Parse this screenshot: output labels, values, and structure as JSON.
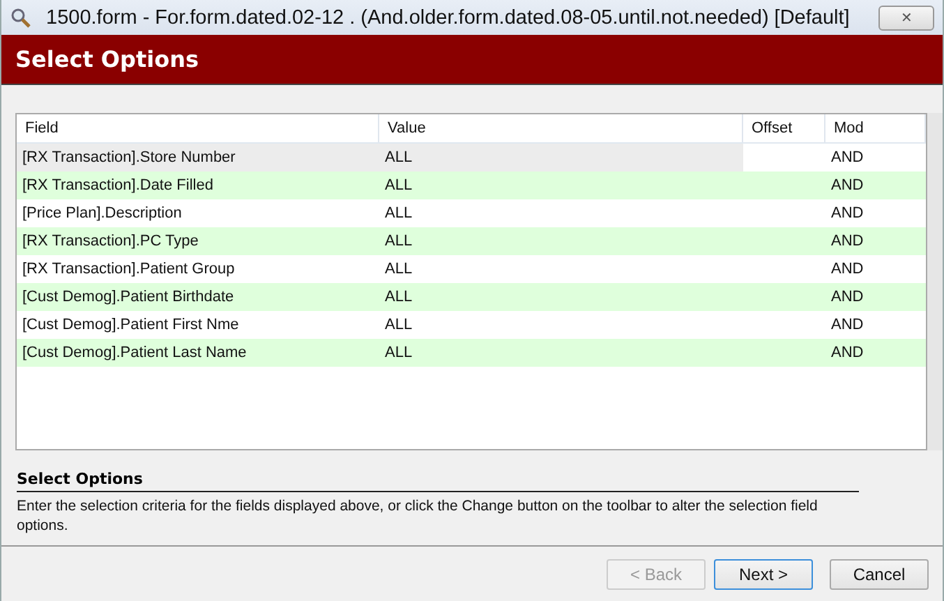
{
  "window": {
    "title": "1500.form - For.form.dated.02-12 . (And.older.form.dated.08-05.until.not.needed) [Default]",
    "close": "✕"
  },
  "header": {
    "title": "Select Options"
  },
  "table": {
    "columns": [
      "Field",
      "Value",
      "Offset",
      "Mod"
    ],
    "rows": [
      {
        "field": "[RX Transaction].Store Number",
        "value": "ALL",
        "mod": "AND",
        "selected": true
      },
      {
        "field": "[RX Transaction].Date Filled",
        "value": "ALL",
        "mod": "AND",
        "selected": false
      },
      {
        "field": "[Price Plan].Description",
        "value": "ALL",
        "mod": "AND",
        "selected": false
      },
      {
        "field": "[RX Transaction].PC Type",
        "value": "ALL",
        "mod": "AND",
        "selected": false
      },
      {
        "field": "[RX Transaction].Patient Group",
        "value": "ALL",
        "mod": "AND",
        "selected": false
      },
      {
        "field": "[Cust Demog].Patient Birthdate",
        "value": "ALL",
        "mod": "AND",
        "selected": false
      },
      {
        "field": "[Cust Demog].Patient First Nme",
        "value": "ALL",
        "mod": "AND",
        "selected": false
      },
      {
        "field": "[Cust Demog].Patient Last Name",
        "value": "ALL",
        "mod": "AND",
        "selected": false
      }
    ]
  },
  "help": {
    "title": "Select Options",
    "text": "Enter the selection criteria for the fields displayed above, or click the Change button on the toolbar to alter the selection field options."
  },
  "buttons": [
    {
      "label": "< Back",
      "disabled": true,
      "default": false
    },
    {
      "label": "Next >",
      "disabled": false,
      "default": true
    },
    {
      "label": "Cancel",
      "disabled": false,
      "default": false
    }
  ]
}
